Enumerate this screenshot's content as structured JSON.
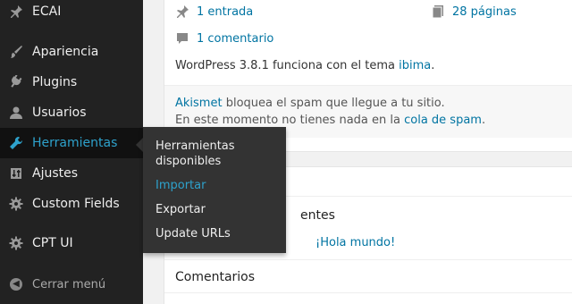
{
  "sidebar": {
    "items": [
      {
        "label": "ECAI"
      },
      {
        "label": "Apariencia"
      },
      {
        "label": "Plugins"
      },
      {
        "label": "Usuarios"
      },
      {
        "label": "Herramientas"
      },
      {
        "label": "Ajustes"
      },
      {
        "label": "Custom Fields"
      },
      {
        "label": "CPT UI"
      }
    ],
    "collapse_label": "Cerrar menú",
    "accent_color": "#2ea2cc"
  },
  "flyout": {
    "items": [
      {
        "label": "Herramientas disponibles"
      },
      {
        "label": "Importar"
      },
      {
        "label": "Exportar"
      },
      {
        "label": "Update URLs"
      }
    ]
  },
  "glance": {
    "posts": "1 entrada",
    "pages": "28 páginas",
    "comments": "1 comentario",
    "version_prefix": "WordPress 3.8.1 funciona con el tema ",
    "theme": "ibima",
    "version_suffix": "."
  },
  "akismet": {
    "link": "Akismet",
    "line1_rest": " bloquea el spam que llegue a tu sitio.",
    "line2_prefix": "En este momento no tienes nada en la ",
    "line2_link": "cola de spam",
    "line2_suffix": "."
  },
  "activity": {
    "section_title_partial": "entes",
    "post_link": "¡Hola mundo!",
    "comments_title": "Comentarios"
  }
}
